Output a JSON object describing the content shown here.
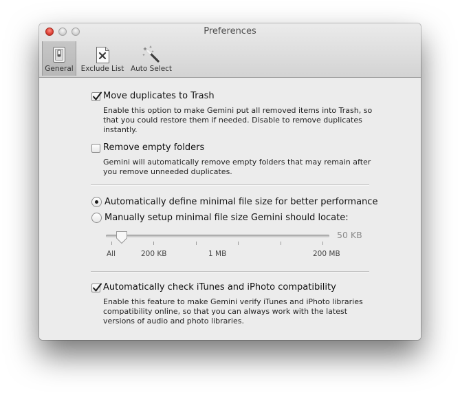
{
  "window": {
    "title": "Preferences"
  },
  "toolbar": {
    "items": [
      {
        "label": "General",
        "icon": "switch-icon",
        "selected": true
      },
      {
        "label": "Exclude List",
        "icon": "exclude-doc-icon",
        "selected": false
      },
      {
        "label": "Auto Select",
        "icon": "magic-wand-icon",
        "selected": false
      }
    ]
  },
  "general": {
    "move_duplicates": {
      "label": "Move duplicates to Trash",
      "checked": true,
      "description": "Enable this option to make Gemini put all removed items into Trash, so\nthat you could restore them if needed. Disable to remove duplicates\ninstantly."
    },
    "remove_empty": {
      "label": "Remove empty folders",
      "checked": false,
      "description": "Gemini will automatically remove empty folders that may remain after\nyou remove unneeded duplicates."
    },
    "size_mode": {
      "auto_label": "Automatically define minimal file size for better performance",
      "manual_label": "Manually setup minimal file size Gemini should locate:",
      "selected": "auto"
    },
    "size_slider": {
      "value": "50 KB",
      "tick_labels": [
        "All",
        "200 KB",
        "1 MB",
        "200 MB"
      ],
      "enabled": false
    },
    "itunes_check": {
      "label": "Automatically check iTunes and iPhoto compatibility",
      "checked": true,
      "description": "Enable this feature to make Gemini verify iTunes and iPhoto libraries\ncompatibility online, so that you can always work with the latest\nversions of audio and photo libraries."
    }
  },
  "colors": {
    "window_bg": "#ececec",
    "close_button": "#e0453a",
    "disabled_text": "#8a8a8a"
  }
}
